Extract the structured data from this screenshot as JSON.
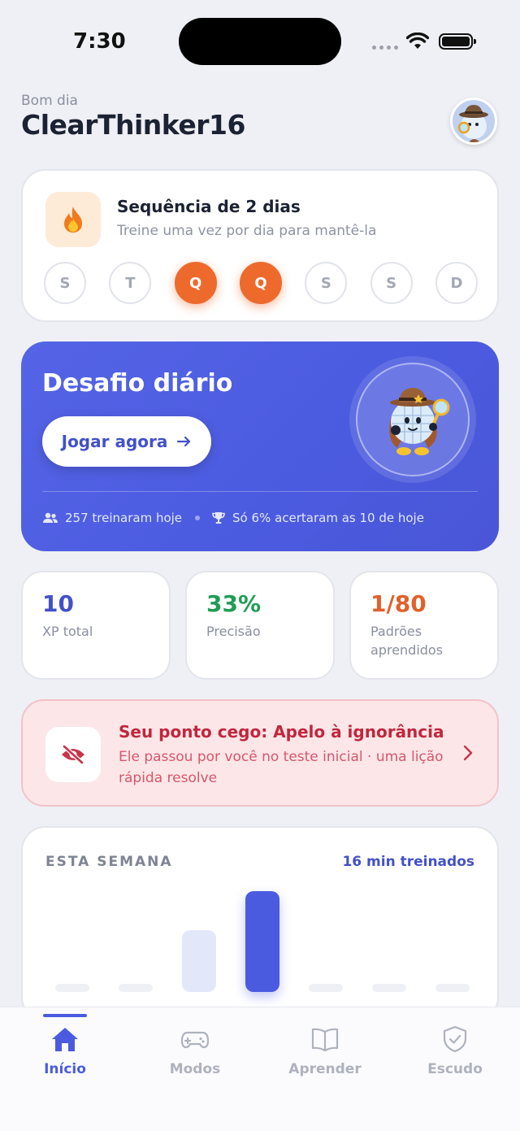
{
  "status": {
    "time": "7:30"
  },
  "header": {
    "greeting": "Bom dia",
    "username": "ClearThinker16"
  },
  "streak": {
    "title": "Sequência de 2 dias",
    "subtitle": "Treine uma vez por dia para mantê-la",
    "days": [
      {
        "letter": "S",
        "done": false
      },
      {
        "letter": "T",
        "done": false
      },
      {
        "letter": "Q",
        "done": true
      },
      {
        "letter": "Q",
        "done": true
      },
      {
        "letter": "S",
        "done": false
      },
      {
        "letter": "S",
        "done": false
      },
      {
        "letter": "D",
        "done": false
      }
    ]
  },
  "challenge": {
    "title": "Desafio diário",
    "button": "Jogar agora",
    "trained_today": "257 treinaram hoje",
    "accuracy_note": "Só 6% acertaram as 10 de hoje"
  },
  "stats": [
    {
      "value": "10",
      "label": "XP total",
      "color": "#4351C8"
    },
    {
      "value": "33%",
      "label": "Precisão",
      "color": "#1F9D55"
    },
    {
      "value": "1/80",
      "label": "Padrões aprendidos",
      "color": "#E0612A"
    }
  ],
  "blind_spot": {
    "title": "Seu ponto cego: Apelo à ignorância",
    "description": "Ele passou por você no teste inicial · uma lição rápida resolve"
  },
  "week": {
    "title": "ESTA SEMANA",
    "total": "16 min treinados"
  },
  "tabs": [
    {
      "label": "Início",
      "icon": "home-icon",
      "active": true
    },
    {
      "label": "Modos",
      "icon": "gamepad-icon",
      "active": false
    },
    {
      "label": "Aprender",
      "icon": "book-icon",
      "active": false
    },
    {
      "label": "Escudo",
      "icon": "shield-icon",
      "active": false
    }
  ],
  "colors": {
    "accent": "#4B5BE0",
    "streak": "#EE6A2C",
    "danger": "#C0273D"
  }
}
